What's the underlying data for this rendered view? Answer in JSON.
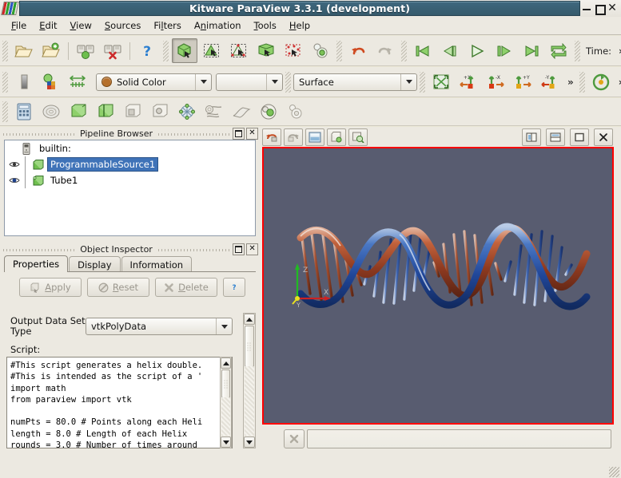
{
  "window": {
    "title": "Kitware ParaView 3.3.1 (development)",
    "logo_icon": "paraview-logo-icon",
    "minimize_label": "minimize-icon",
    "maximize_label": "maximize-icon",
    "close_label": "✕",
    "accent_title_bg": "#3a6073",
    "selection_blue": "#3f73b8",
    "viewport_bg": "#585c70",
    "active_view_border": "#ff0000"
  },
  "menubar": {
    "items": [
      {
        "label": "File",
        "mnemonic": "F"
      },
      {
        "label": "Edit",
        "mnemonic": "E"
      },
      {
        "label": "View",
        "mnemonic": "V"
      },
      {
        "label": "Sources",
        "mnemonic": "S"
      },
      {
        "label": "Filters",
        "mnemonic": "l"
      },
      {
        "label": "Animation",
        "mnemonic": "n"
      },
      {
        "label": "Tools",
        "mnemonic": "T"
      },
      {
        "label": "Help",
        "mnemonic": "H"
      }
    ]
  },
  "toolbars": {
    "main": {
      "buttons": [
        {
          "name": "open-file-icon",
          "tip": "Open"
        },
        {
          "name": "open-recent-icon",
          "tip": "Open Recent"
        },
        {
          "name": "connect-server-icon",
          "tip": "Connect"
        },
        {
          "name": "disconnect-server-icon",
          "tip": "Disconnect"
        },
        {
          "name": "help-icon",
          "tip": "Help"
        }
      ],
      "selection_buttons": [
        {
          "name": "interact-icon",
          "tip": "Interact",
          "pressed": true
        },
        {
          "name": "select-cells-on-icon",
          "tip": "Select Cells On"
        },
        {
          "name": "select-points-on-icon",
          "tip": "Select Points On"
        },
        {
          "name": "select-cells-through-icon",
          "tip": "Select Cells Through"
        },
        {
          "name": "select-points-through-icon",
          "tip": "Select Points Through"
        },
        {
          "name": "select-block-icon",
          "tip": "Select Block"
        }
      ],
      "vcr_buttons": [
        {
          "name": "undo-icon",
          "tip": "Undo"
        },
        {
          "name": "redo-icon",
          "tip": "Redo"
        },
        {
          "name": "first-frame-icon",
          "tip": "First Frame"
        },
        {
          "name": "previous-frame-icon",
          "tip": "Previous Frame"
        },
        {
          "name": "play-icon",
          "tip": "Play"
        },
        {
          "name": "next-frame-icon",
          "tip": "Next Frame"
        },
        {
          "name": "last-frame-icon",
          "tip": "Last Frame"
        },
        {
          "name": "loop-icon",
          "tip": "Loop"
        }
      ],
      "time_label": "Time:",
      "overflow_label": "»"
    },
    "display": {
      "buttons": [
        {
          "name": "color-legend-icon",
          "tip": "Toggle Color Legend"
        },
        {
          "name": "edit-color-map-icon",
          "tip": "Edit Color Map"
        },
        {
          "name": "rescale-range-icon",
          "tip": "Rescale to Data Range"
        }
      ],
      "color_by": {
        "value": "Solid Color",
        "swatch": "#b5702c"
      },
      "array_component": {
        "value": ""
      },
      "representation": {
        "value": "Surface"
      },
      "camera_buttons": [
        {
          "name": "reset-camera-icon",
          "tip": "Reset Camera"
        },
        {
          "name": "camera-neg-x-icon",
          "tip": "+X"
        },
        {
          "name": "camera-pos-x-icon",
          "tip": "-X"
        },
        {
          "name": "camera-pos-y-icon",
          "tip": "+Y"
        },
        {
          "name": "camera-neg-y-icon",
          "tip": "-Y"
        }
      ],
      "overflow_label": "»",
      "rotate_button": {
        "name": "rotate-90-icon",
        "tip": "Rotate 90"
      },
      "overflow2_label": "»"
    },
    "sources": {
      "buttons": [
        {
          "name": "calculator-icon",
          "tip": "Calculator"
        },
        {
          "name": "contour-icon",
          "tip": "Contour"
        },
        {
          "name": "clip-icon",
          "tip": "Clip"
        },
        {
          "name": "slice-icon",
          "tip": "Slice"
        },
        {
          "name": "threshold-icon",
          "tip": "Threshold"
        },
        {
          "name": "extract-subset-icon",
          "tip": "Extract Subset"
        },
        {
          "name": "glyph-icon",
          "tip": "Glyph"
        },
        {
          "name": "stream-tracer-icon",
          "tip": "Stream Tracer"
        },
        {
          "name": "warp-icon",
          "tip": "Warp"
        },
        {
          "name": "group-datasets-icon",
          "tip": "Group Datasets"
        },
        {
          "name": "extract-level-icon",
          "tip": "Extract Level"
        }
      ]
    }
  },
  "pipeline_browser": {
    "title": "Pipeline Browser",
    "float_button": "float-dock-icon",
    "close_button": "✕",
    "items": [
      {
        "label": "builtin:",
        "icon": "server-icon",
        "eye": false,
        "selected": false,
        "indent": 0
      },
      {
        "label": "ProgrammableSource1",
        "icon": "source-green-cube-icon",
        "eye": true,
        "selected": true,
        "indent": 1
      },
      {
        "label": "Tube1",
        "icon": "filter-green-cube-icon",
        "eye": true,
        "selected": false,
        "indent": 1
      }
    ]
  },
  "object_inspector": {
    "title": "Object Inspector",
    "float_button": "float-dock-icon",
    "close_button": "✕",
    "tabs": [
      {
        "label": "Properties",
        "active": true
      },
      {
        "label": "Display",
        "active": false
      },
      {
        "label": "Information",
        "active": false
      }
    ],
    "buttons": [
      {
        "label": "Apply",
        "mnemonic": "A",
        "icon": "apply-icon",
        "enabled": false
      },
      {
        "label": "Reset",
        "mnemonic": "R",
        "icon": "reset-icon",
        "enabled": false
      },
      {
        "label": "Delete",
        "mnemonic": "D",
        "icon": "delete-icon",
        "enabled": false
      },
      {
        "label": "?",
        "icon": "help-icon",
        "enabled": true
      }
    ],
    "output_type": {
      "label_line1": "Output Data Set",
      "label_line2": "Type",
      "value": "vtkPolyData"
    },
    "script": {
      "label": "Script:",
      "text": "#This script generates a helix double.\n#This is intended as the script of a '\nimport math\nfrom paraview import vtk\n\nnumPts = 80.0 # Points along each Heli\nlength = 8.0 # Length of each Helix\nrounds = 3.0 # Number of times around"
    }
  },
  "render_view": {
    "toolbar_buttons": [
      {
        "name": "undo-camera-icon",
        "tip": "Undo Camera"
      },
      {
        "name": "redo-camera-icon",
        "tip": "Redo Camera"
      },
      {
        "name": "adjust-camera-icon",
        "tip": "Adjust Camera"
      },
      {
        "name": "capture-screenshot-icon",
        "tip": "Capture Screenshot"
      },
      {
        "name": "save-screenshot-icon",
        "tip": "Save Screenshot"
      }
    ],
    "layout_buttons": [
      {
        "name": "split-horizontal-icon",
        "tip": "Split Horizontal"
      },
      {
        "name": "split-vertical-icon",
        "tip": "Split Vertical"
      },
      {
        "name": "maximize-view-icon",
        "tip": "Maximize"
      },
      {
        "name": "close-view-icon",
        "tip": "Close"
      }
    ],
    "scene": {
      "description": "DNA double-helix rendered as tubes with ladder rungs",
      "helix_a_color": "#a34a2c",
      "helix_b_color": "#2a58a8",
      "background": "#585c70",
      "turns": 5
    },
    "orientation_axes": {
      "x_label": "X",
      "y_label": "Y",
      "z_label": "Z",
      "x_color": "#cc2222",
      "y_color": "#e8e020",
      "z_color": "#22bb22",
      "origin_color": "#e8e020"
    }
  },
  "status_bar": {
    "cancel_button": "cancel-icon",
    "message": "",
    "progress_value": ""
  }
}
